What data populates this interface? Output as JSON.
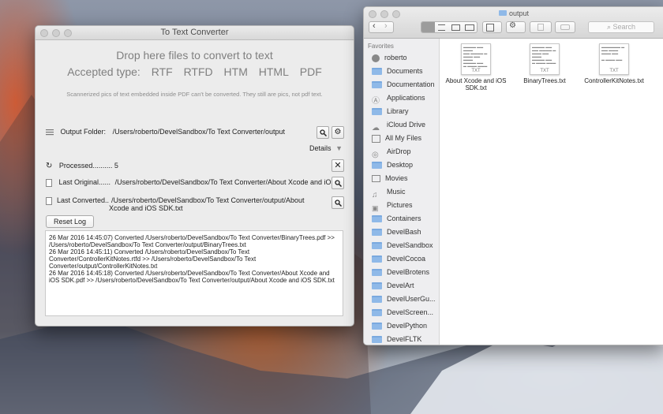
{
  "converter": {
    "title": "To Text Converter",
    "drop_text": "Drop here files to convert to text",
    "accepted_label": "Accepted type:",
    "types": [
      "RTF",
      "RTFD",
      "HTM",
      "HTML",
      "PDF"
    ],
    "note": "Scannerized pics of text embedded inside PDF can't be converted. They still are pics, not pdf text.",
    "output_folder_label": "Output Folder:",
    "output_folder_path": "/Users/roberto/DevelSandbox/To Text Converter/output",
    "details_label": "Details",
    "processed_label": "Processed.......... 5",
    "last_original_label": "Last Original......",
    "last_original_path": "/Users/roberto/DevelSandbox/To Text Converter/About Xcode and iOS",
    "last_converted_label": "Last Converted..",
    "last_converted_path": "/Users/roberto/DevelSandbox/To Text Converter/output/About Xcode and iOS SDK.txt",
    "reset_label": "Reset Log",
    "log_lines": [
      "26 Mar 2016 14:45:07) Converted /Users/roberto/DevelSandbox/To Text Converter/BinaryTrees.pdf  >>  /Users/roberto/DevelSandbox/To Text Converter/output/BinaryTrees.txt",
      "26 Mar 2016 14:45:11) Converted /Users/roberto/DevelSandbox/To Text Converter/ControllerKitNotes.rtfd  >>  /Users/roberto/DevelSandbox/To Text Converter/output/ControllerKitNotes.txt",
      "26 Mar 2016 14:45:18) Converted /Users/roberto/DevelSandbox/To Text Converter/About Xcode and iOS SDK.pdf  >>  /Users/roberto/DevelSandbox/To Text Converter/output/About Xcode and iOS SDK.txt"
    ]
  },
  "finder": {
    "title": "output",
    "search_placeholder": "Search",
    "favorites_label": "Favorites",
    "sidebar": [
      {
        "label": "roberto",
        "icon": "user-icon"
      },
      {
        "label": "Documents",
        "icon": "documents-icon"
      },
      {
        "label": "Documentation",
        "icon": "folder-icon"
      },
      {
        "label": "Applications",
        "icon": "applications-icon"
      },
      {
        "label": "Library",
        "icon": "folder-icon"
      },
      {
        "label": "iCloud Drive",
        "icon": "cloud-icon"
      },
      {
        "label": "All My Files",
        "icon": "all-files-icon"
      },
      {
        "label": "AirDrop",
        "icon": "airdrop-icon"
      },
      {
        "label": "Desktop",
        "icon": "folder-icon"
      },
      {
        "label": "Movies",
        "icon": "movies-icon"
      },
      {
        "label": "Music",
        "icon": "music-icon"
      },
      {
        "label": "Pictures",
        "icon": "pictures-icon"
      },
      {
        "label": "Containers",
        "icon": "folder-icon"
      },
      {
        "label": "DevelBash",
        "icon": "folder-icon"
      },
      {
        "label": "DevelSandbox",
        "icon": "folder-icon"
      },
      {
        "label": "DevelCocoa",
        "icon": "folder-icon"
      },
      {
        "label": "DevelBrotens",
        "icon": "folder-icon"
      },
      {
        "label": "DevelArt",
        "icon": "folder-icon"
      },
      {
        "label": "DevelUserGu...",
        "icon": "folder-icon"
      },
      {
        "label": "DevelScreen...",
        "icon": "folder-icon"
      },
      {
        "label": "DevelPython",
        "icon": "folder-icon"
      },
      {
        "label": "DevelFLTK",
        "icon": "folder-icon"
      }
    ],
    "files": [
      {
        "name": "About Xcode and iOS SDK.txt",
        "ext": "TXT"
      },
      {
        "name": "BinaryTrees.txt",
        "ext": "TXT"
      },
      {
        "name": "ControllerKitNotes.txt",
        "ext": "TXT"
      }
    ]
  },
  "colors": {
    "accent_folder": "#8fb9e8",
    "window_bg": "#ececec"
  }
}
